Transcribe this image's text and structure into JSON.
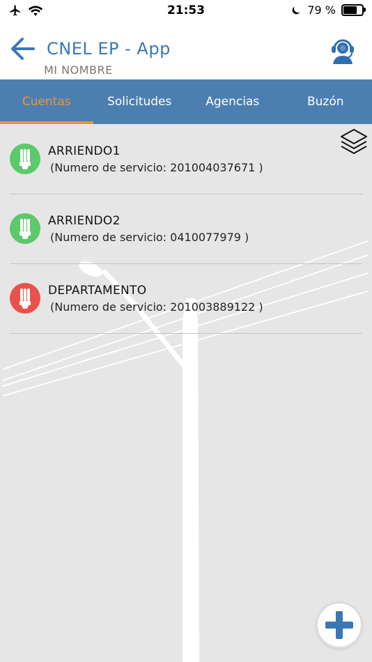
{
  "status_bar": {
    "time": "21:53",
    "battery_text": "79 %",
    "battery_level": 0.79,
    "icons": [
      "airplane-icon",
      "wifi-icon",
      "moon-icon",
      "battery-icon"
    ]
  },
  "header": {
    "title": "CNEL EP - App",
    "subtitle": "MI NOMBRE",
    "back_icon": "arrow-left-icon",
    "support_icon": "headset-support-icon"
  },
  "tabs": [
    {
      "label": "Cuentas",
      "active": true
    },
    {
      "label": "Solicitudes",
      "active": false
    },
    {
      "label": "Agencias",
      "active": false
    },
    {
      "label": "Buzón",
      "active": false
    }
  ],
  "accounts": [
    {
      "name": "ARRIENDO1",
      "service": " (Numero de servicio: 201004037671 )",
      "status_color": "#5cc96a"
    },
    {
      "name": "ARRIENDO2",
      "service": " (Numero de servicio: 0410077979 )",
      "status_color": "#5cc96a"
    },
    {
      "name": "DEPARTAMENTO",
      "service": " (Numero de servicio: 201003889122 )",
      "status_color": "#e8524a"
    }
  ],
  "colors": {
    "accent_blue": "#3a78b5",
    "tab_bar": "#4c7fb0",
    "active_tab": "#f0923a",
    "fab_plus": "#3a78b5"
  },
  "actions": {
    "layers_icon": "layers-icon",
    "add_icon": "plus-icon"
  }
}
